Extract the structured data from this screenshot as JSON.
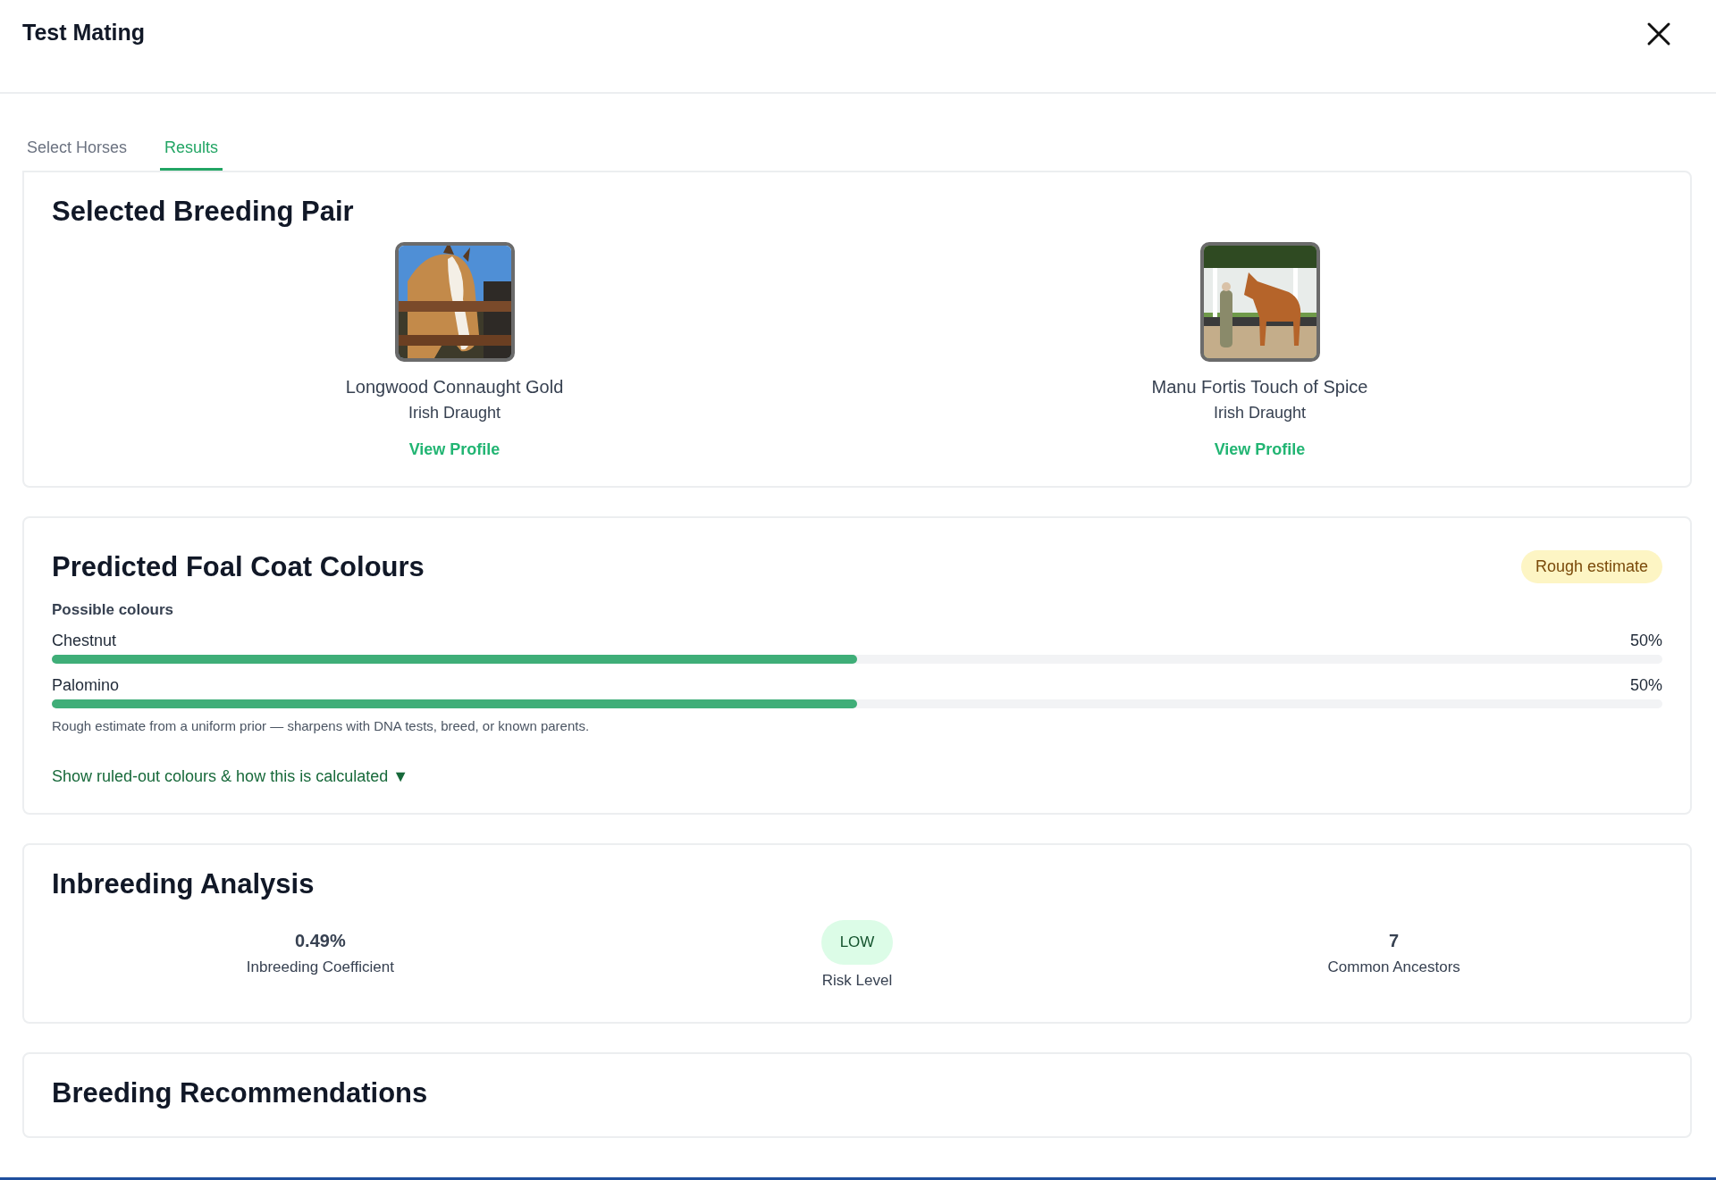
{
  "window": {
    "title": "Test Mating"
  },
  "tabs": [
    {
      "label": "Select Horses",
      "selected": false
    },
    {
      "label": "Results",
      "selected": true
    }
  ],
  "breeding_pair": {
    "title": "Selected Breeding Pair",
    "horses": [
      {
        "name": "Longwood Connaught Gold",
        "breed": "Irish Draught",
        "link": "View Profile"
      },
      {
        "name": "Manu Fortis Touch of Spice",
        "breed": "Irish Draught",
        "link": "View Profile"
      }
    ]
  },
  "coat_colours": {
    "title": "Predicted Foal Coat Colours",
    "badge": "Rough estimate",
    "subtitle": "Possible colours",
    "colours": [
      {
        "name": "Chestnut",
        "level": 0.5,
        "reading": "50%"
      },
      {
        "name": "Palomino",
        "level": 0.5,
        "reading": "50%"
      }
    ],
    "note": "Rough estimate from a uniform prior — sharpens with DNA tests, breed, or known parents.",
    "toggle": "Show ruled-out colours & how this is calculated ▼"
  },
  "inbreeding": {
    "title": "Inbreeding Analysis",
    "stats": [
      {
        "kind": "value",
        "value": "0.49%",
        "label": "Inbreeding Coefficient"
      },
      {
        "kind": "badge",
        "value": "LOW",
        "label": "Risk Level"
      },
      {
        "kind": "value",
        "value": "7",
        "label": "Common Ancestors"
      }
    ]
  },
  "recommendations": {
    "title": "Breeding Recommendations"
  }
}
